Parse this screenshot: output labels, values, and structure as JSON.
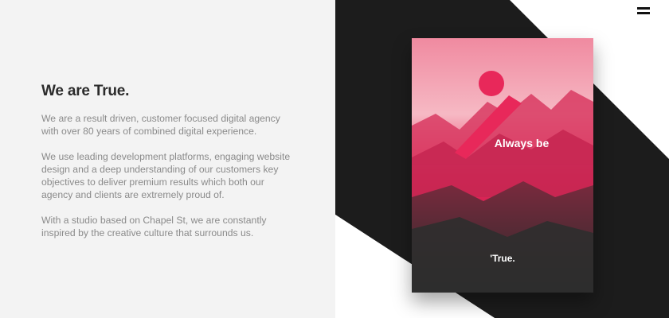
{
  "about": {
    "heading": "We are True.",
    "paragraphs": [
      "We are a result driven, customer focused digital agency with over 80 years of combined digital experience.",
      "We use leading development platforms, engaging website design and a deep understanding of our customers key objectives to deliver premium results which both our agency and clients are extremely proud of.",
      "With a studio based on Chapel St, we are constantly inspired by the creative culture that surrounds us."
    ]
  },
  "poster": {
    "tagline": "Always be",
    "logo": "'True."
  },
  "colors": {
    "accent": "#e8285a",
    "dark": "#1c1c1c",
    "left_bg": "#f3f3f3",
    "text_muted": "#8a8a8a"
  },
  "icons": {
    "menu": "hamburger-menu-icon"
  }
}
